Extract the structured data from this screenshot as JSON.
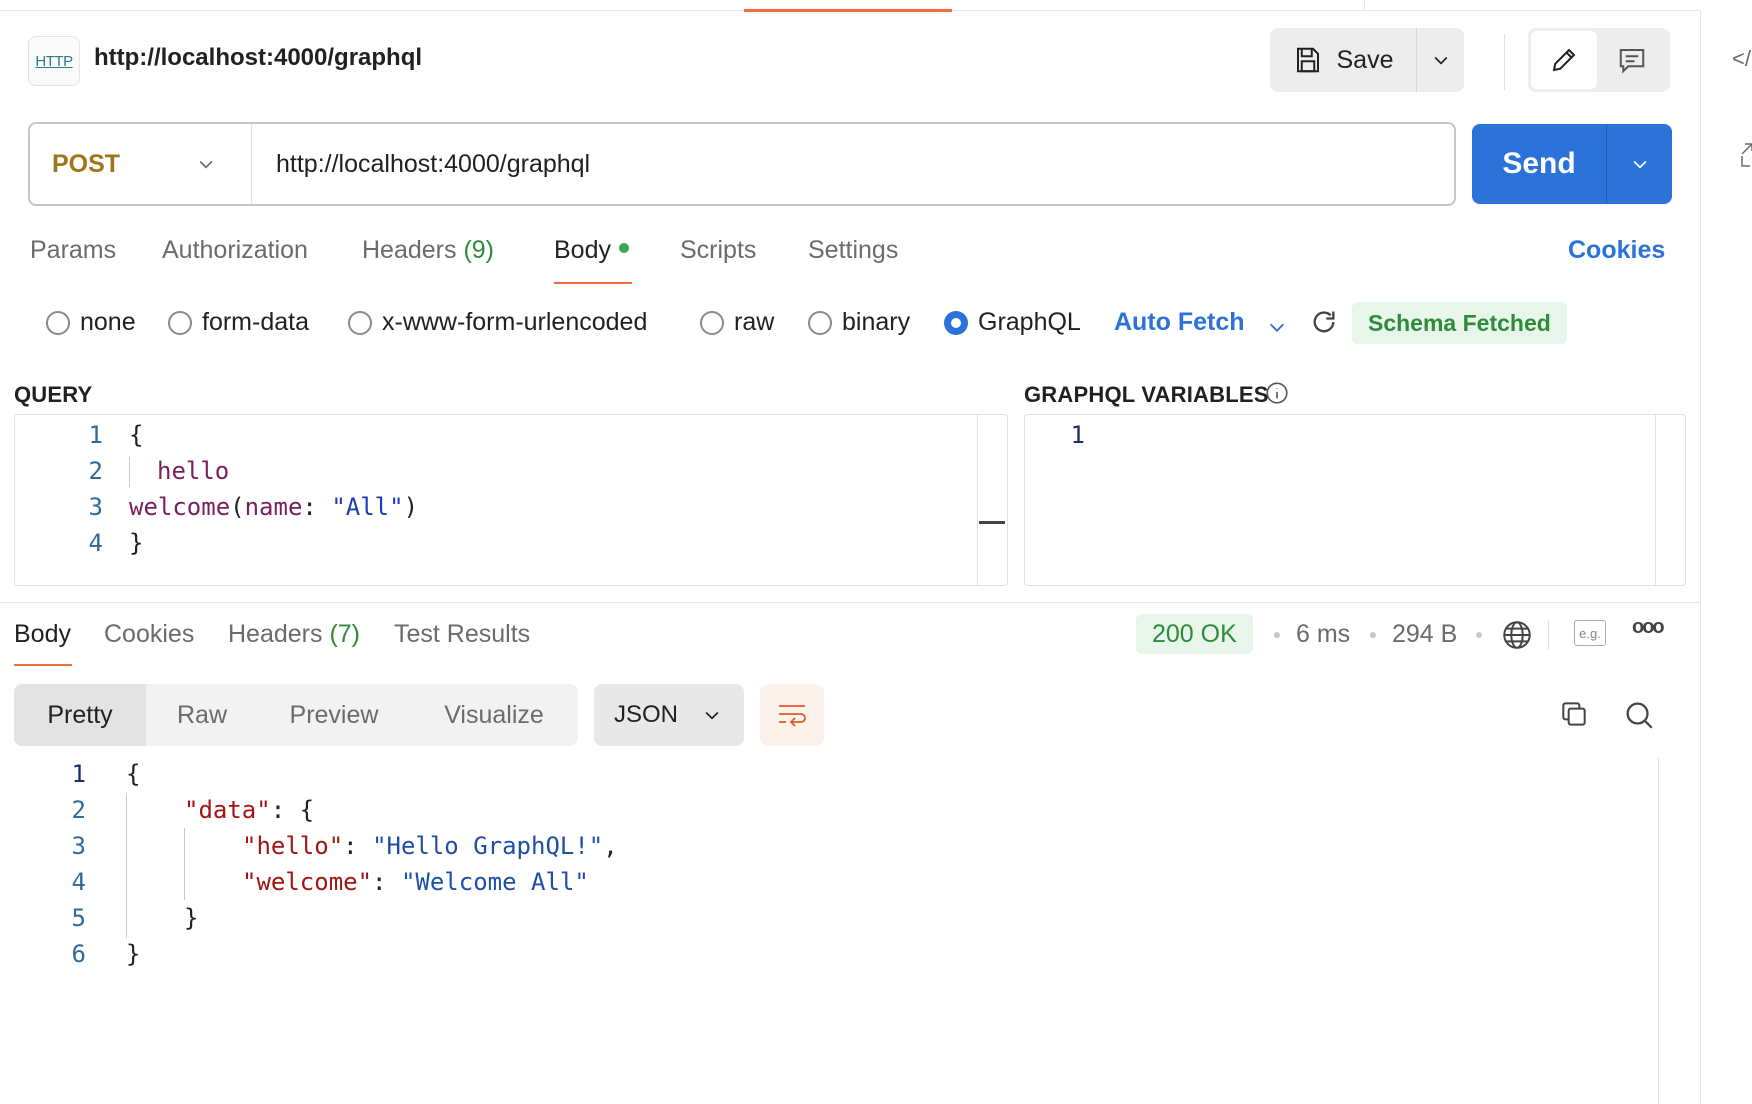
{
  "request": {
    "title": "http://localhost:4000/graphql",
    "http_badge": "HTTP",
    "method": "POST",
    "url": "http://localhost:4000/graphql",
    "save_label": "Save",
    "send_label": "Send",
    "rail_code": "</"
  },
  "request_tabs": {
    "params": "Params",
    "authorization": "Authorization",
    "headers": "Headers",
    "headers_count": "(9)",
    "body": "Body",
    "scripts": "Scripts",
    "settings": "Settings",
    "cookies": "Cookies"
  },
  "body_types": {
    "none": "none",
    "form_data": "form-data",
    "urlencoded": "x-www-form-urlencoded",
    "raw": "raw",
    "binary": "binary",
    "graphql": "GraphQL",
    "selected": "GraphQL",
    "auto_fetch": "Auto Fetch",
    "schema_status": "Schema Fetched"
  },
  "query_editor": {
    "label": "QUERY",
    "line_numbers": [
      "1",
      "2",
      "3",
      "4"
    ],
    "lines": {
      "l1": "{",
      "l2_field": "hello",
      "l3_field": "welcome",
      "l3_open": "(",
      "l3_arg": "name",
      "l3_colon": ": ",
      "l3_str": "\"All\"",
      "l3_close": ")",
      "l4": "}"
    }
  },
  "variables_editor": {
    "label": "GRAPHQL VARIABLES",
    "line_numbers": [
      "1"
    ]
  },
  "response_tabs": {
    "body": "Body",
    "cookies": "Cookies",
    "headers": "Headers",
    "headers_count": "(7)",
    "test_results": "Test Results"
  },
  "response_meta": {
    "status": "200 OK",
    "status_color": "#2e8b3a",
    "time": "6 ms",
    "size": "294 B",
    "example_label": "e.g.",
    "more": "ooo"
  },
  "response_view": {
    "tabs": [
      "Pretty",
      "Raw",
      "Preview",
      "Visualize"
    ],
    "active_tab": "Pretty",
    "format": "JSON",
    "line_numbers": [
      "1",
      "2",
      "3",
      "4",
      "5",
      "6"
    ],
    "lines": {
      "l1": "{",
      "l2_key": "\"data\"",
      "l2_rest": ": {",
      "l3_key": "\"hello\"",
      "l3_colon": ": ",
      "l3_val": "\"Hello GraphQL!\"",
      "l3_comma": ",",
      "l4_key": "\"welcome\"",
      "l4_colon": ": ",
      "l4_val": "\"Welcome All\"",
      "l5": "}",
      "l6": "}"
    }
  },
  "colors": {
    "accent": "#f26b3a",
    "primary": "#2b73d8",
    "method_post": "#a07419",
    "success": "#2e8b3a"
  }
}
